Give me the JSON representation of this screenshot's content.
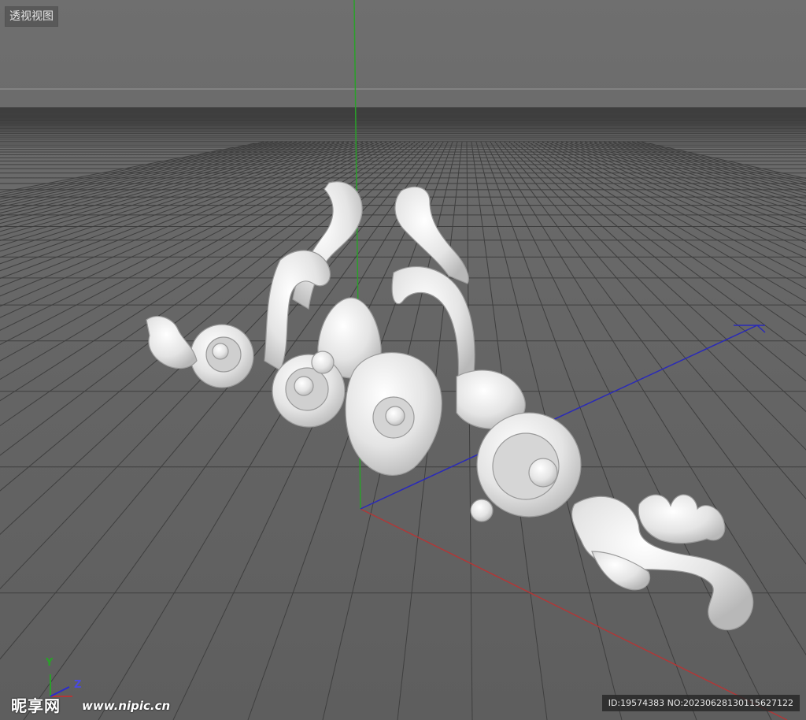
{
  "viewport": {
    "label": "透视视图",
    "axis_y_label": "Y",
    "axis_z_label": "Z",
    "colors": {
      "x_axis": "#c03030",
      "y_axis": "#2aa02a",
      "z_axis": "#2a2ad0",
      "grid": "#3c3c3c",
      "model": "#ececec"
    }
  },
  "watermark": {
    "logo": "昵享网",
    "url": "www.nipic.cn",
    "id_text": "ID:19574383 NO:20230628130115627122"
  }
}
